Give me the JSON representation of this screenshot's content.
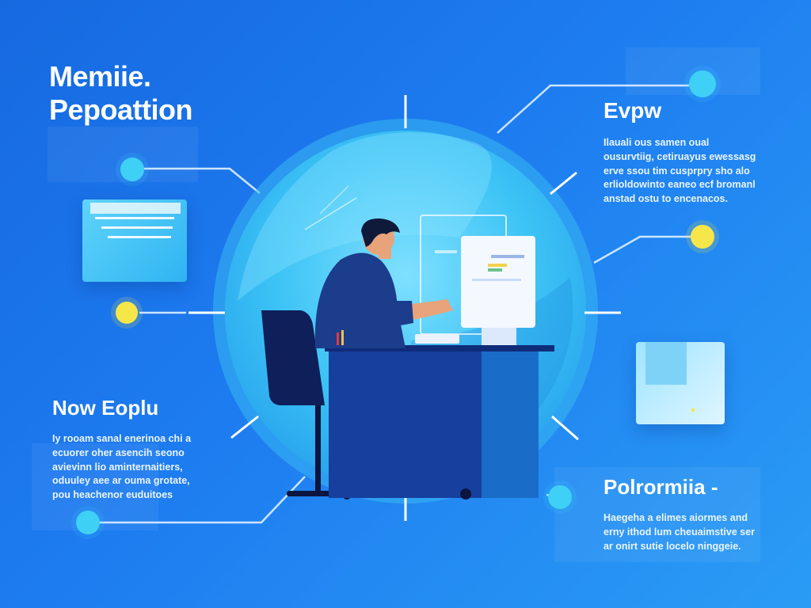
{
  "hero": {
    "title_line1": "Memiie.",
    "title_line2": "Pepoattion"
  },
  "sections": {
    "top_right": {
      "title": "Evpw",
      "body": "Ilauali ous samen oual ousurvtiig, cetiruayus ewessasg erve ssou tim cusprpry sho alo erlioldowinto eaneo ecf bromanl anstad ostu to encenacos."
    },
    "bottom_left": {
      "title": "Now Eoplu",
      "body": "Iy rooam sanal enerinoa chi a ecuorer oher asencih seono avievinn lio aminternaitiers, oduuley aee ar ouma grotate, pou heachenor euduitoes"
    },
    "bottom_right": {
      "title": "Polrormiia -",
      "body": "Haegeha a elimes aiormes and erny ithod lum cheuaimstive ser ar onirt sutie locelo ninggeie."
    }
  },
  "icons": {
    "left_card": "document-icon",
    "right_card": "envelope-icon",
    "person": "person-at-desk-icon",
    "monitor": "monitor-icon",
    "chair": "office-chair-icon"
  },
  "colors": {
    "background": "#1d7cf0",
    "circle": "#3fc0f4",
    "accent_cyan": "#3fd0f6",
    "accent_yellow": "#f6e64a",
    "desk": "#173f9e",
    "shirt": "#1c3c8c",
    "skin": "#e8a37a"
  }
}
